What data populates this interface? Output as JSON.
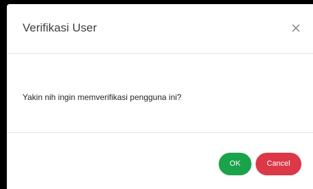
{
  "modal": {
    "title": "Verifikasi User",
    "close_icon": "close-icon",
    "message": "Yakin nih ingin memverifikasi pengguna ini?",
    "buttons": {
      "ok_label": "OK",
      "cancel_label": "Cancel"
    }
  },
  "colors": {
    "ok_button": "#1aa34a",
    "cancel_button": "#dc3848",
    "backdrop": "#000000"
  }
}
